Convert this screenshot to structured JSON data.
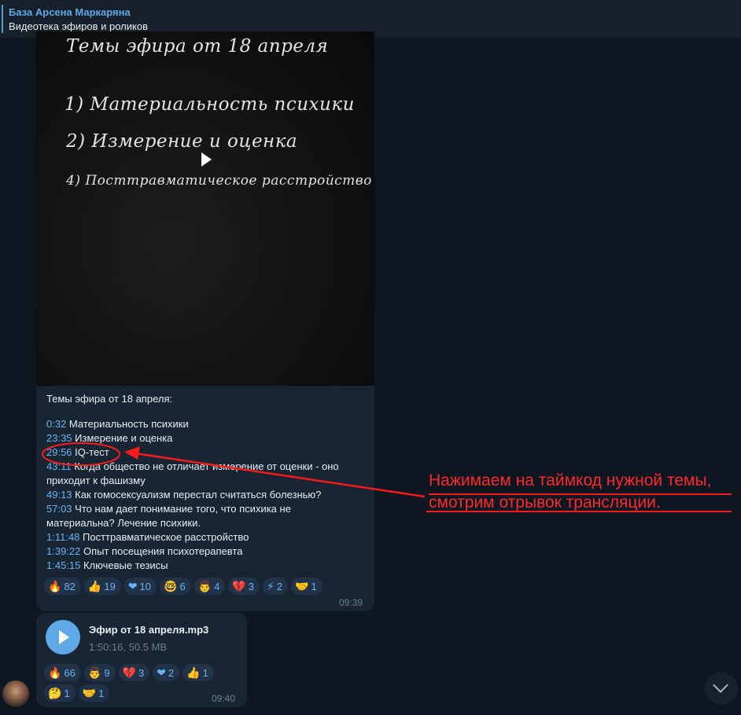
{
  "header": {
    "title": "База Арсена Маркаряна",
    "subtitle": "Видеотека эфиров и роликов"
  },
  "video": {
    "chalk_lines": [
      "Темы эфира от 18 апреля",
      "1) Материальность психики",
      "2) Измерение и оценка",
      "4) Посттравматическое расстройство"
    ]
  },
  "caption": {
    "heading": "Темы эфира от 18 апреля:",
    "topics": [
      {
        "ts": "0:32",
        "text": " Материальность психики"
      },
      {
        "ts": "23:35",
        "text": " Измерение и оценка"
      },
      {
        "ts": "29:56",
        "text": " IQ-тест"
      },
      {
        "ts": "43:11",
        "text": " Когда общество не отличает измерение от оценки - оно"
      },
      {
        "ts": "",
        "text": "приходит к фашизму"
      },
      {
        "ts": "49:13",
        "text": " Как гомосексуализм перестал считаться болезнью?"
      },
      {
        "ts": "57:03",
        "text": " Что нам дает понимание того, что психика не"
      },
      {
        "ts": "",
        "text": "материальна? Лечение психики."
      },
      {
        "ts": "1:11:48",
        "text": " Посттравматическое расстройство"
      },
      {
        "ts": "1:39:22",
        "text": " Опыт посещения психотерапевта"
      },
      {
        "ts": "1:45:15",
        "text": " Ключевые тезисы"
      }
    ]
  },
  "video_reactions": [
    {
      "emoji": "🔥",
      "count": "82"
    },
    {
      "emoji": "👍",
      "count": "19"
    },
    {
      "emoji": "❤",
      "count": "10"
    },
    {
      "emoji": "🤓",
      "count": "6"
    },
    {
      "emoji": "👨",
      "count": "4"
    },
    {
      "emoji": "💔",
      "count": "3"
    },
    {
      "emoji": "⚡",
      "count": "2"
    },
    {
      "emoji": "🤝",
      "count": "1"
    }
  ],
  "video_time": "09:39",
  "audio": {
    "name": "Эфир от 18 апреля.mp3",
    "meta": "1:50:16, 50.5 MB",
    "time": "09:40",
    "reactions_row1": [
      {
        "emoji": "🔥",
        "count": "66"
      },
      {
        "emoji": "👨",
        "count": "9"
      },
      {
        "emoji": "💔",
        "count": "3"
      },
      {
        "emoji": "❤",
        "count": "2"
      },
      {
        "emoji": "👍",
        "count": "1"
      }
    ],
    "reactions_row2": [
      {
        "emoji": "🤔",
        "count": "1"
      },
      {
        "emoji": "🤝",
        "count": "1"
      }
    ]
  },
  "annotation": {
    "line1": "Нажимаем на таймкод нужной темы,",
    "line2": "смотрим отрывок трансляции.",
    "color": "#ff2a2a"
  }
}
